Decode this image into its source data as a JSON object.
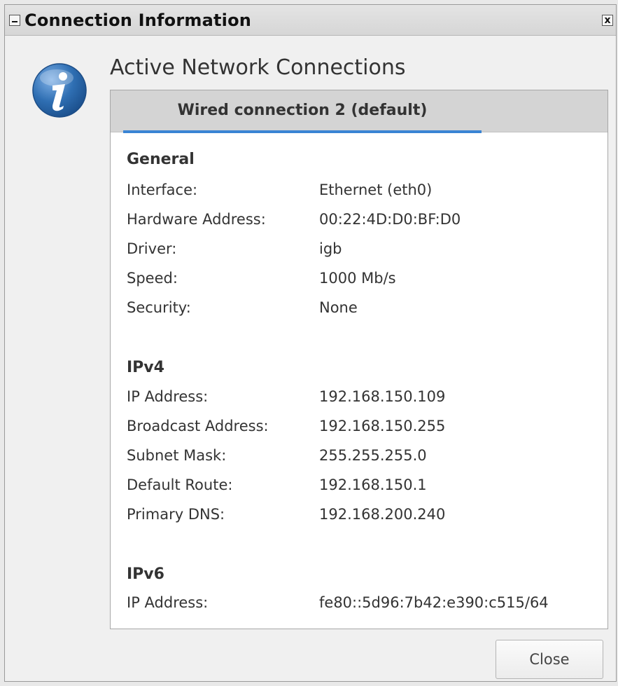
{
  "window": {
    "title": "Connection Information",
    "close_glyph": "x"
  },
  "heading": "Active Network Connections",
  "tab": {
    "label": "Wired connection 2 (default)"
  },
  "sections": [
    {
      "title": "General",
      "rows": [
        {
          "label": "Interface:",
          "value": "Ethernet (eth0)"
        },
        {
          "label": "Hardware Address:",
          "value": "00:22:4D:D0:BF:D0"
        },
        {
          "label": "Driver:",
          "value": "igb"
        },
        {
          "label": "Speed:",
          "value": "1000 Mb/s"
        },
        {
          "label": "Security:",
          "value": "None"
        }
      ]
    },
    {
      "title": "IPv4",
      "rows": [
        {
          "label": "IP Address:",
          "value": "192.168.150.109"
        },
        {
          "label": "Broadcast Address:",
          "value": "192.168.150.255"
        },
        {
          "label": "Subnet Mask:",
          "value": "255.255.255.0"
        },
        {
          "label": "Default Route:",
          "value": "192.168.150.1"
        },
        {
          "label": "Primary DNS:",
          "value": "192.168.200.240"
        }
      ]
    },
    {
      "title": "IPv6",
      "rows": [
        {
          "label": "IP Address:",
          "value": "fe80::5d96:7b42:e390:c515/64"
        }
      ]
    }
  ],
  "buttons": {
    "close_label": "Close"
  },
  "icons": {
    "info": "info-icon",
    "minimize": "minimize-icon",
    "close": "close-icon"
  },
  "colors": {
    "tab_accent": "#3a84d4",
    "info_icon": "#2f6fb3"
  }
}
